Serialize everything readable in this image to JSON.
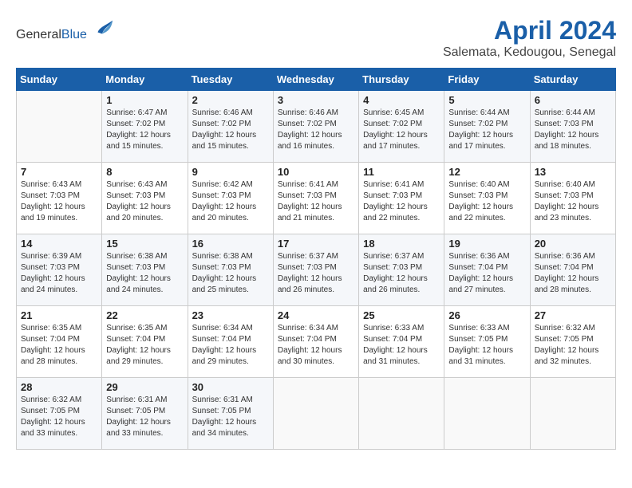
{
  "header": {
    "logo_general": "General",
    "logo_blue": "Blue",
    "month_year": "April 2024",
    "location": "Salemata, Kedougou, Senegal"
  },
  "days_of_week": [
    "Sunday",
    "Monday",
    "Tuesday",
    "Wednesday",
    "Thursday",
    "Friday",
    "Saturday"
  ],
  "weeks": [
    [
      {
        "day": "",
        "sunrise": "",
        "sunset": "",
        "daylight": ""
      },
      {
        "day": "1",
        "sunrise": "Sunrise: 6:47 AM",
        "sunset": "Sunset: 7:02 PM",
        "daylight": "Daylight: 12 hours and 15 minutes."
      },
      {
        "day": "2",
        "sunrise": "Sunrise: 6:46 AM",
        "sunset": "Sunset: 7:02 PM",
        "daylight": "Daylight: 12 hours and 15 minutes."
      },
      {
        "day": "3",
        "sunrise": "Sunrise: 6:46 AM",
        "sunset": "Sunset: 7:02 PM",
        "daylight": "Daylight: 12 hours and 16 minutes."
      },
      {
        "day": "4",
        "sunrise": "Sunrise: 6:45 AM",
        "sunset": "Sunset: 7:02 PM",
        "daylight": "Daylight: 12 hours and 17 minutes."
      },
      {
        "day": "5",
        "sunrise": "Sunrise: 6:44 AM",
        "sunset": "Sunset: 7:02 PM",
        "daylight": "Daylight: 12 hours and 17 minutes."
      },
      {
        "day": "6",
        "sunrise": "Sunrise: 6:44 AM",
        "sunset": "Sunset: 7:03 PM",
        "daylight": "Daylight: 12 hours and 18 minutes."
      }
    ],
    [
      {
        "day": "7",
        "sunrise": "Sunrise: 6:43 AM",
        "sunset": "Sunset: 7:03 PM",
        "daylight": "Daylight: 12 hours and 19 minutes."
      },
      {
        "day": "8",
        "sunrise": "Sunrise: 6:43 AM",
        "sunset": "Sunset: 7:03 PM",
        "daylight": "Daylight: 12 hours and 20 minutes."
      },
      {
        "day": "9",
        "sunrise": "Sunrise: 6:42 AM",
        "sunset": "Sunset: 7:03 PM",
        "daylight": "Daylight: 12 hours and 20 minutes."
      },
      {
        "day": "10",
        "sunrise": "Sunrise: 6:41 AM",
        "sunset": "Sunset: 7:03 PM",
        "daylight": "Daylight: 12 hours and 21 minutes."
      },
      {
        "day": "11",
        "sunrise": "Sunrise: 6:41 AM",
        "sunset": "Sunset: 7:03 PM",
        "daylight": "Daylight: 12 hours and 22 minutes."
      },
      {
        "day": "12",
        "sunrise": "Sunrise: 6:40 AM",
        "sunset": "Sunset: 7:03 PM",
        "daylight": "Daylight: 12 hours and 22 minutes."
      },
      {
        "day": "13",
        "sunrise": "Sunrise: 6:40 AM",
        "sunset": "Sunset: 7:03 PM",
        "daylight": "Daylight: 12 hours and 23 minutes."
      }
    ],
    [
      {
        "day": "14",
        "sunrise": "Sunrise: 6:39 AM",
        "sunset": "Sunset: 7:03 PM",
        "daylight": "Daylight: 12 hours and 24 minutes."
      },
      {
        "day": "15",
        "sunrise": "Sunrise: 6:38 AM",
        "sunset": "Sunset: 7:03 PM",
        "daylight": "Daylight: 12 hours and 24 minutes."
      },
      {
        "day": "16",
        "sunrise": "Sunrise: 6:38 AM",
        "sunset": "Sunset: 7:03 PM",
        "daylight": "Daylight: 12 hours and 25 minutes."
      },
      {
        "day": "17",
        "sunrise": "Sunrise: 6:37 AM",
        "sunset": "Sunset: 7:03 PM",
        "daylight": "Daylight: 12 hours and 26 minutes."
      },
      {
        "day": "18",
        "sunrise": "Sunrise: 6:37 AM",
        "sunset": "Sunset: 7:03 PM",
        "daylight": "Daylight: 12 hours and 26 minutes."
      },
      {
        "day": "19",
        "sunrise": "Sunrise: 6:36 AM",
        "sunset": "Sunset: 7:04 PM",
        "daylight": "Daylight: 12 hours and 27 minutes."
      },
      {
        "day": "20",
        "sunrise": "Sunrise: 6:36 AM",
        "sunset": "Sunset: 7:04 PM",
        "daylight": "Daylight: 12 hours and 28 minutes."
      }
    ],
    [
      {
        "day": "21",
        "sunrise": "Sunrise: 6:35 AM",
        "sunset": "Sunset: 7:04 PM",
        "daylight": "Daylight: 12 hours and 28 minutes."
      },
      {
        "day": "22",
        "sunrise": "Sunrise: 6:35 AM",
        "sunset": "Sunset: 7:04 PM",
        "daylight": "Daylight: 12 hours and 29 minutes."
      },
      {
        "day": "23",
        "sunrise": "Sunrise: 6:34 AM",
        "sunset": "Sunset: 7:04 PM",
        "daylight": "Daylight: 12 hours and 29 minutes."
      },
      {
        "day": "24",
        "sunrise": "Sunrise: 6:34 AM",
        "sunset": "Sunset: 7:04 PM",
        "daylight": "Daylight: 12 hours and 30 minutes."
      },
      {
        "day": "25",
        "sunrise": "Sunrise: 6:33 AM",
        "sunset": "Sunset: 7:04 PM",
        "daylight": "Daylight: 12 hours and 31 minutes."
      },
      {
        "day": "26",
        "sunrise": "Sunrise: 6:33 AM",
        "sunset": "Sunset: 7:05 PM",
        "daylight": "Daylight: 12 hours and 31 minutes."
      },
      {
        "day": "27",
        "sunrise": "Sunrise: 6:32 AM",
        "sunset": "Sunset: 7:05 PM",
        "daylight": "Daylight: 12 hours and 32 minutes."
      }
    ],
    [
      {
        "day": "28",
        "sunrise": "Sunrise: 6:32 AM",
        "sunset": "Sunset: 7:05 PM",
        "daylight": "Daylight: 12 hours and 33 minutes."
      },
      {
        "day": "29",
        "sunrise": "Sunrise: 6:31 AM",
        "sunset": "Sunset: 7:05 PM",
        "daylight": "Daylight: 12 hours and 33 minutes."
      },
      {
        "day": "30",
        "sunrise": "Sunrise: 6:31 AM",
        "sunset": "Sunset: 7:05 PM",
        "daylight": "Daylight: 12 hours and 34 minutes."
      },
      {
        "day": "",
        "sunrise": "",
        "sunset": "",
        "daylight": ""
      },
      {
        "day": "",
        "sunrise": "",
        "sunset": "",
        "daylight": ""
      },
      {
        "day": "",
        "sunrise": "",
        "sunset": "",
        "daylight": ""
      },
      {
        "day": "",
        "sunrise": "",
        "sunset": "",
        "daylight": ""
      }
    ]
  ]
}
